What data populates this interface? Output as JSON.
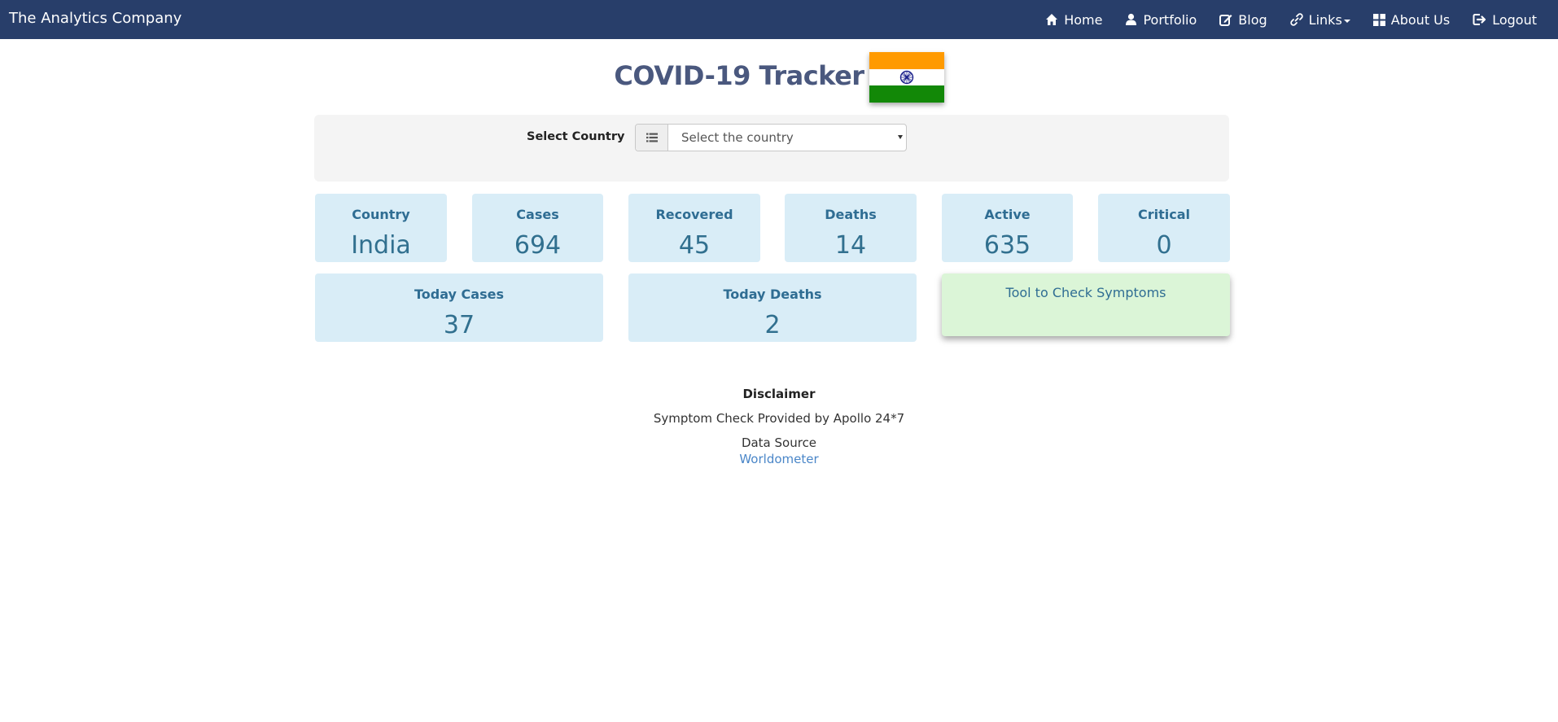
{
  "navbar": {
    "brand": "The Analytics Company",
    "items": [
      {
        "label": "Home",
        "icon": "home-icon"
      },
      {
        "label": "Portfolio",
        "icon": "user-icon"
      },
      {
        "label": "Blog",
        "icon": "edit-icon"
      },
      {
        "label": "Links",
        "icon": "link-icon",
        "dropdown": true
      },
      {
        "label": "About Us",
        "icon": "grid-icon"
      },
      {
        "label": "Logout",
        "icon": "logout-icon"
      }
    ]
  },
  "header": {
    "title": "COVID-19 Tracker",
    "flag": "india-flag",
    "flag_colors": {
      "saffron": "#ff9a00",
      "white": "#ffffff",
      "green": "#128807",
      "chakra": "#1a1f8a"
    }
  },
  "country_select": {
    "label": "Select Country",
    "placeholder": "Select the country",
    "icon": "list-icon"
  },
  "stats": {
    "country": {
      "label": "Country",
      "value": "India"
    },
    "cases": {
      "label": "Cases",
      "value": "694"
    },
    "recovered": {
      "label": "Recovered",
      "value": "45"
    },
    "deaths": {
      "label": "Deaths",
      "value": "14"
    },
    "active": {
      "label": "Active",
      "value": "635"
    },
    "critical": {
      "label": "Critical",
      "value": "0"
    },
    "today_cases": {
      "label": "Today Cases",
      "value": "37"
    },
    "today_deaths": {
      "label": "Today Deaths",
      "value": "2"
    }
  },
  "symptom_tool": {
    "label": "Tool to Check Symptoms"
  },
  "footer": {
    "disclaimer": "Disclaimer",
    "symptom_note": "Symptom Check Provided by Apollo 24*7",
    "data_source": "Data Source",
    "source_link": "Worldometer"
  },
  "colors": {
    "navbar": "#283e6a",
    "card": "#d9edf7",
    "card_text": "#31708f",
    "symptom_card": "#dbf5d7",
    "link": "#4a86c8"
  }
}
